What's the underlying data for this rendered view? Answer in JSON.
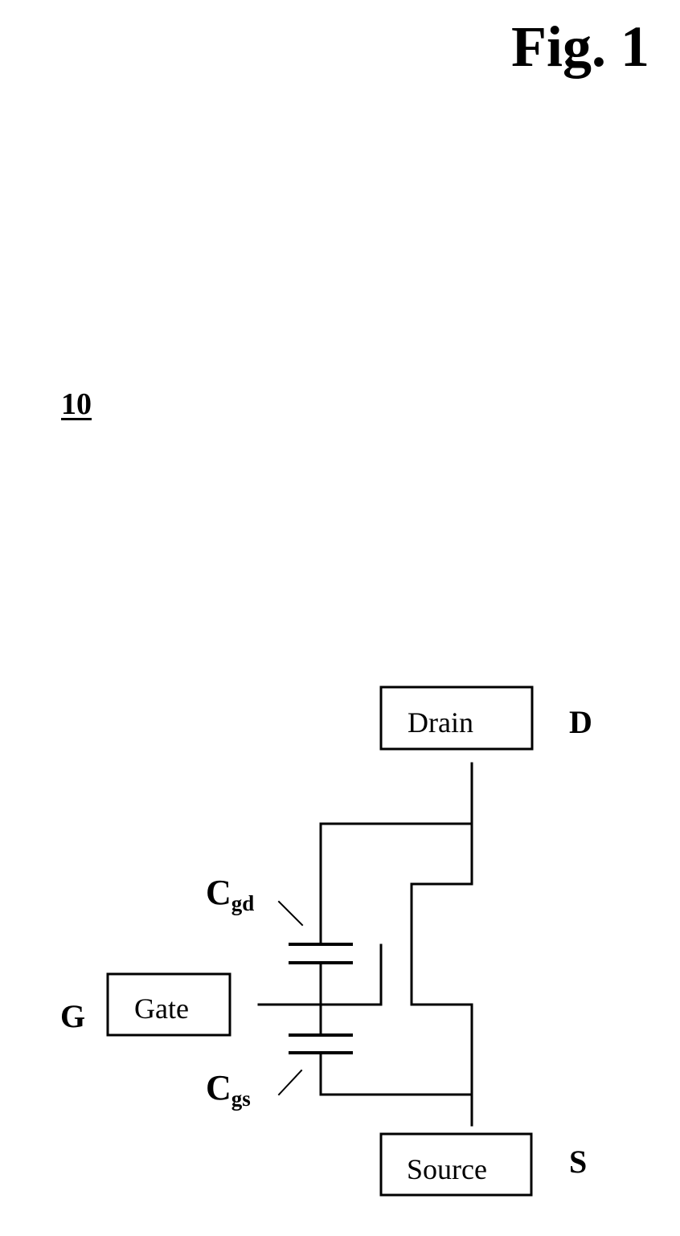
{
  "figure": {
    "title": "Fig. 1",
    "reference_number": "10"
  },
  "circuit": {
    "blocks": {
      "drain": {
        "label": "Drain",
        "terminal": "D"
      },
      "gate": {
        "label": "Gate",
        "terminal": "G"
      },
      "source": {
        "label": "Source",
        "terminal": "S"
      }
    },
    "capacitors": {
      "cgd": {
        "main": "C",
        "sub": "gd"
      },
      "cgs": {
        "main": "C",
        "sub": "gs"
      }
    },
    "colors": {
      "ink": "#000000",
      "background": "#ffffff"
    }
  }
}
